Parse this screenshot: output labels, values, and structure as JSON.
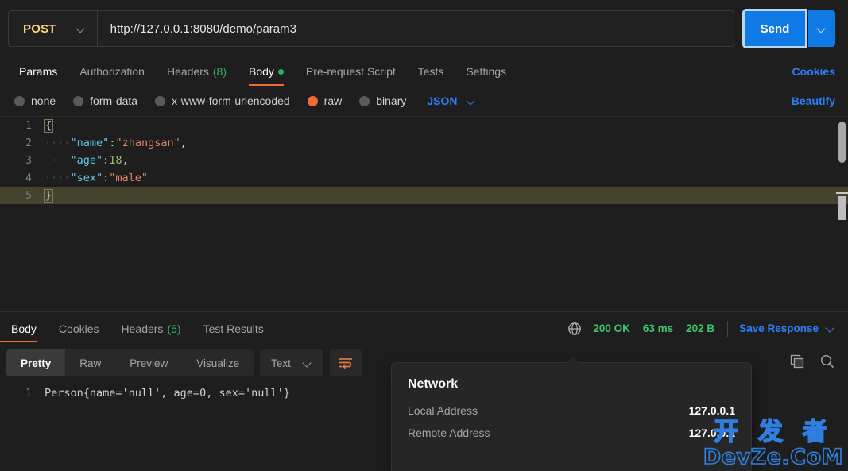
{
  "request": {
    "method": "POST",
    "url": "http://127.0.0.1:8080/demo/param3",
    "send_label": "Send",
    "tabs": [
      {
        "label": "Params",
        "count": "",
        "active": false
      },
      {
        "label": "Authorization",
        "count": "",
        "active": false
      },
      {
        "label": "Headers",
        "count": "(8)",
        "active": false
      },
      {
        "label": "Body",
        "count": "",
        "active": true
      },
      {
        "label": "Pre-request Script",
        "count": "",
        "active": false
      },
      {
        "label": "Tests",
        "count": "",
        "active": false
      },
      {
        "label": "Settings",
        "count": "",
        "active": false
      }
    ],
    "cookies_link": "Cookies",
    "body_types": [
      {
        "label": "none",
        "selected": false
      },
      {
        "label": "form-data",
        "selected": false
      },
      {
        "label": "x-www-form-urlencoded",
        "selected": false
      },
      {
        "label": "raw",
        "selected": true
      },
      {
        "label": "binary",
        "selected": false
      }
    ],
    "raw_format": "JSON",
    "beautify_label": "Beautify",
    "body_lines": [
      {
        "num": "1",
        "indent": "",
        "content": "{",
        "active": false
      },
      {
        "num": "2",
        "indent": "····",
        "key": "\"name\"",
        "colon": ":",
        "value": "\"zhangsan\"",
        "value_type": "string",
        "tail": ",",
        "active": false
      },
      {
        "num": "3",
        "indent": "····",
        "key": "\"age\"",
        "colon": ":",
        "value": "18",
        "value_type": "number",
        "tail": ",",
        "active": false
      },
      {
        "num": "4",
        "indent": "····",
        "key": "\"sex\"",
        "colon": ":",
        "value": "\"male\"",
        "value_type": "string",
        "tail": "",
        "active": false
      },
      {
        "num": "5",
        "indent": "",
        "content": "}",
        "active": true
      }
    ]
  },
  "response": {
    "tabs": [
      {
        "label": "Body",
        "count": "",
        "active": true
      },
      {
        "label": "Cookies",
        "count": "",
        "active": false
      },
      {
        "label": "Headers",
        "count": "(5)",
        "active": false
      },
      {
        "label": "Test Results",
        "count": "",
        "active": false
      }
    ],
    "status_code": "200 OK",
    "time": "63 ms",
    "size": "202 B",
    "save_label": "Save Response",
    "view_modes": [
      {
        "label": "Pretty",
        "active": true
      },
      {
        "label": "Raw",
        "active": false
      },
      {
        "label": "Preview",
        "active": false
      },
      {
        "label": "Visualize",
        "active": false
      }
    ],
    "format": "Text",
    "body_line_num": "1",
    "body_text": "Person{name='null', age=0, sex='null'}"
  },
  "tooltip": {
    "title": "Network",
    "rows": [
      {
        "key": "Local Address",
        "value": "127.0.0.1"
      },
      {
        "key": "Remote Address",
        "value": "127.0.0.1"
      }
    ]
  },
  "watermark": {
    "cn": "开 发 者",
    "en": "DevZe.CoM"
  },
  "colors": {
    "accent_blue": "#0f7ae5",
    "link_blue": "#2d7ff9",
    "active_orange": "#f06a35",
    "status_green": "#3ec46d",
    "method_gold": "#ffd479"
  }
}
